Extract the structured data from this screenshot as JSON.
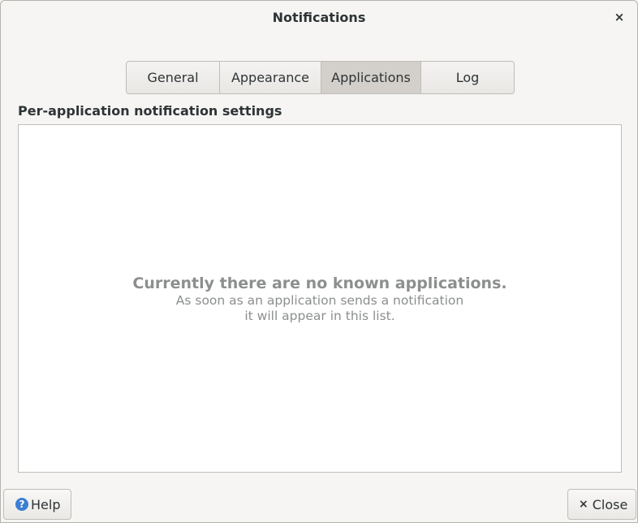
{
  "window": {
    "title": "Notifications",
    "close_glyph": "×"
  },
  "tabs": [
    {
      "label": "General",
      "active": false
    },
    {
      "label": "Appearance",
      "active": false
    },
    {
      "label": "Applications",
      "active": true
    },
    {
      "label": "Log",
      "active": false
    }
  ],
  "section": {
    "heading": "Per-application notification settings"
  },
  "empty_state": {
    "title": "Currently there are no known applications.",
    "line1": "As soon as an application sends a notification",
    "line2": "it will appear in this list."
  },
  "footer": {
    "help_label": "Help",
    "help_icon_glyph": "?",
    "close_label": "Close",
    "close_icon_glyph": "×"
  },
  "colors": {
    "background": "#f6f5f4",
    "active_tab": "#d3cfca",
    "help_icon": "#3d7fd1",
    "muted_text": "#8c8f8e"
  }
}
